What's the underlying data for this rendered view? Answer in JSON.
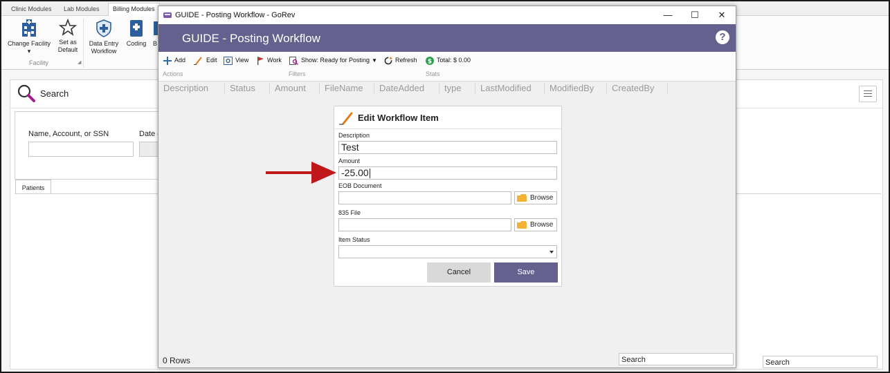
{
  "bg_app": {
    "top_tabs": [
      "Clinic Modules",
      "Lab Modules",
      "Billing Modules"
    ],
    "ribbon": {
      "change_facility": "Change Facility",
      "set_default_1": "Set as",
      "set_default_2": "Default",
      "data_entry_1": "Data Entry",
      "data_entry_2": "Workflow",
      "coding": "Coding",
      "partial_btn": "B",
      "group_label": "Facility"
    },
    "search": {
      "title": "Search",
      "name_label": "Name, Account, or SSN",
      "date_label": "Date o",
      "patients_tab": "Patients",
      "bottom_search": "Search"
    }
  },
  "window": {
    "title": "GUIDE - Posting Workflow - GoRev",
    "minimize": "—",
    "maximize": "☐",
    "close": "✕",
    "banner_title": "GUIDE - Posting Workflow",
    "help": "?"
  },
  "toolbar": {
    "add": "Add",
    "edit": "Edit",
    "view": "View",
    "work": "Work",
    "show": "Show: Ready for Posting",
    "refresh": "Refresh",
    "total": "Total: $ 0.00",
    "section_actions": "Actions",
    "section_filters": "Filters",
    "section_stats": "Stats"
  },
  "grid": {
    "columns": [
      "Description",
      "Status",
      "Amount",
      "FileName",
      "DateAdded",
      "type",
      "LastModified",
      "ModifiedBy",
      "CreatedBy"
    ],
    "rows_count": "0 Rows",
    "search_placeholder": "Search"
  },
  "dialog": {
    "title": "Edit Workflow Item",
    "description_label": "Description",
    "description_value": "Test",
    "amount_label": "Amount",
    "amount_value": "-25.00",
    "eob_label": "EOB Document",
    "eob_browse": "Browse",
    "file835_label": "835 File",
    "file835_browse": "Browse",
    "status_label": "Item Status",
    "cancel": "Cancel",
    "save": "Save"
  },
  "colors": {
    "accent": "#65618f",
    "annotation_arrow": "#c0171b"
  }
}
